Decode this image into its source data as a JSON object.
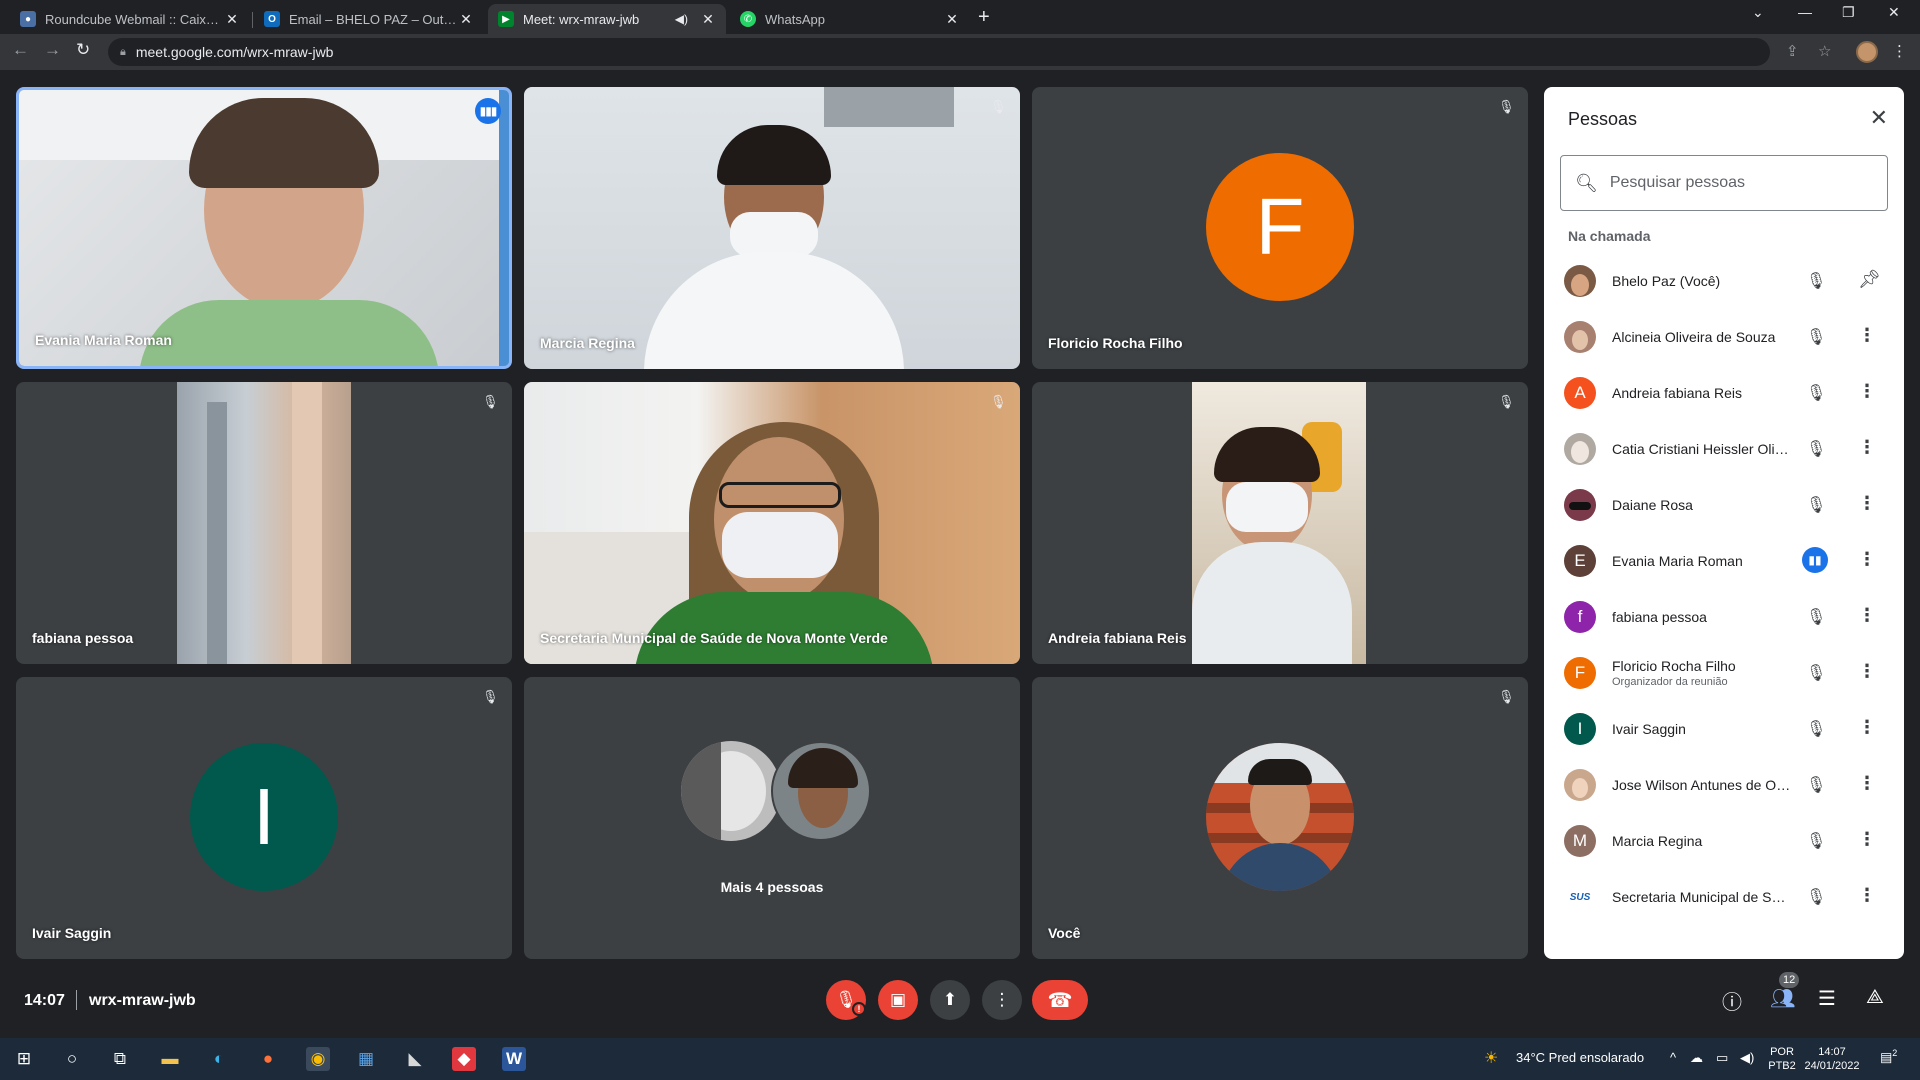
{
  "browser": {
    "tabs": [
      {
        "title": "Roundcube Webmail :: Caixa de entrada",
        "fav_color": "#4a6fa5",
        "icon": "roundcube-icon"
      },
      {
        "title": "Email – BHELO PAZ – Outlook",
        "fav_color": "#0f6cbd",
        "icon": "outlook-icon"
      },
      {
        "title": "Meet: wrx-mraw-jwb",
        "fav_color": "#00832d",
        "icon": "meet-icon"
      },
      {
        "title": "WhatsApp",
        "fav_color": "#25d366",
        "icon": "whatsapp-icon"
      }
    ],
    "url": "meet.google.com/wrx-mraw-jwb"
  },
  "tiles": [
    {
      "name": "Evania Maria Roman"
    },
    {
      "name": "Marcia Regina"
    },
    {
      "name": "Floricio Rocha Filho",
      "initial": "F",
      "color": "#ef6c00"
    },
    {
      "name": "fabiana pessoa"
    },
    {
      "name": "Secretaria Municipal de Saúde de Nova Monte Verde"
    },
    {
      "name": "Andreia fabiana Reis"
    },
    {
      "name": "Ivair Saggin",
      "initial": "I",
      "color": "#00594c"
    },
    {
      "more_label": "Mais 4 pessoas"
    },
    {
      "name": "Você"
    }
  ],
  "bottom": {
    "time": "14:07",
    "code": "wrx-mraw-jwb",
    "people_count": "12"
  },
  "panel": {
    "title": "Pessoas",
    "search_placeholder": "Pesquisar pessoas",
    "section": "Na chamada",
    "people": [
      {
        "name": "Bhelo Paz (Você)",
        "initial": "",
        "color": "#7a5a44",
        "action": "pin"
      },
      {
        "name": "Alcineia Oliveira de Souza",
        "initial": "",
        "color": "#a88070",
        "action": "more"
      },
      {
        "name": "Andreia fabiana Reis",
        "initial": "A",
        "color": "#f4511e",
        "action": "more"
      },
      {
        "name": "Catia Cristiani Heissler Oliveira",
        "initial": "",
        "color": "#b0a9a2",
        "action": "more"
      },
      {
        "name": "Daiane Rosa",
        "initial": "",
        "color": "#7a3a4a",
        "action": "more"
      },
      {
        "name": "Evania Maria Roman",
        "initial": "E",
        "color": "#5d4037",
        "action": "more",
        "speaking": true
      },
      {
        "name": "fabiana pessoa",
        "initial": "f",
        "color": "#8e24aa",
        "action": "more"
      },
      {
        "name": "Floricio Rocha Filho",
        "sub": "Organizador da reunião",
        "initial": "F",
        "color": "#ef6c00",
        "action": "more"
      },
      {
        "name": "Ivair Saggin",
        "initial": "I",
        "color": "#00594c",
        "action": "more"
      },
      {
        "name": "Jose Wilson Antunes de Oliveira",
        "initial": "",
        "color": "#c9a78c",
        "action": "more"
      },
      {
        "name": "Marcia Regina",
        "initial": "M",
        "color": "#8d6e63",
        "action": "more"
      },
      {
        "name": "Secretaria Municipal de Saúde",
        "initial": "SUS",
        "color": "#ffffff",
        "action": "more"
      }
    ]
  },
  "taskbar": {
    "weather": "34°C  Pred ensolarado",
    "lang1": "POR",
    "lang2": "PTB2",
    "time": "14:07",
    "date": "24/01/2022",
    "notif": "2"
  }
}
